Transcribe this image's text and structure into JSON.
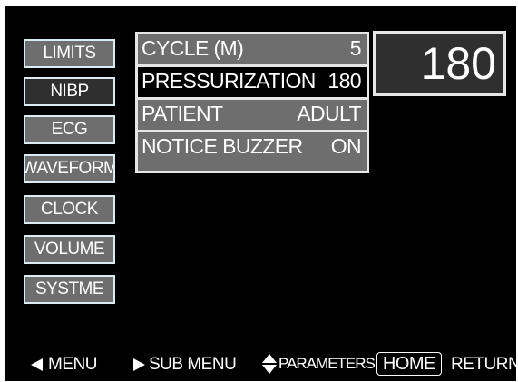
{
  "colors": {
    "screen_bg": "#000000",
    "button_bg": "#6e6e6e",
    "button_active_bg": "#2f2f2f",
    "button_border": "#d8ecf6",
    "text": "#ffffff"
  },
  "sidebar": {
    "items": [
      {
        "label": "LIMITS",
        "active": false
      },
      {
        "label": "NIBP",
        "active": true
      },
      {
        "label": "ECG",
        "active": false
      },
      {
        "label": "WAVEFORM",
        "active": false
      },
      {
        "label": "CLOCK",
        "active": false
      },
      {
        "label": "VOLUME",
        "active": false
      },
      {
        "label": "SYSTME",
        "active": false
      }
    ]
  },
  "params": {
    "rows": [
      {
        "label": "CYCLE (M)",
        "value": "5"
      },
      {
        "label": "PRESSURIZATION",
        "value": "180"
      },
      {
        "label": "PATIENT",
        "value": "ADULT"
      },
      {
        "label": "NOTICE BUZZER",
        "value": "ON"
      }
    ]
  },
  "display": {
    "value": "180"
  },
  "footer": {
    "menu": "MENU",
    "submenu": "SUB MENU",
    "parameters": "PARAMETERS",
    "home": "HOME",
    "return": "RETURN",
    "icons": [
      "triangle-left-icon",
      "triangle-right-icon",
      "up-down-arrows-icon"
    ]
  }
}
